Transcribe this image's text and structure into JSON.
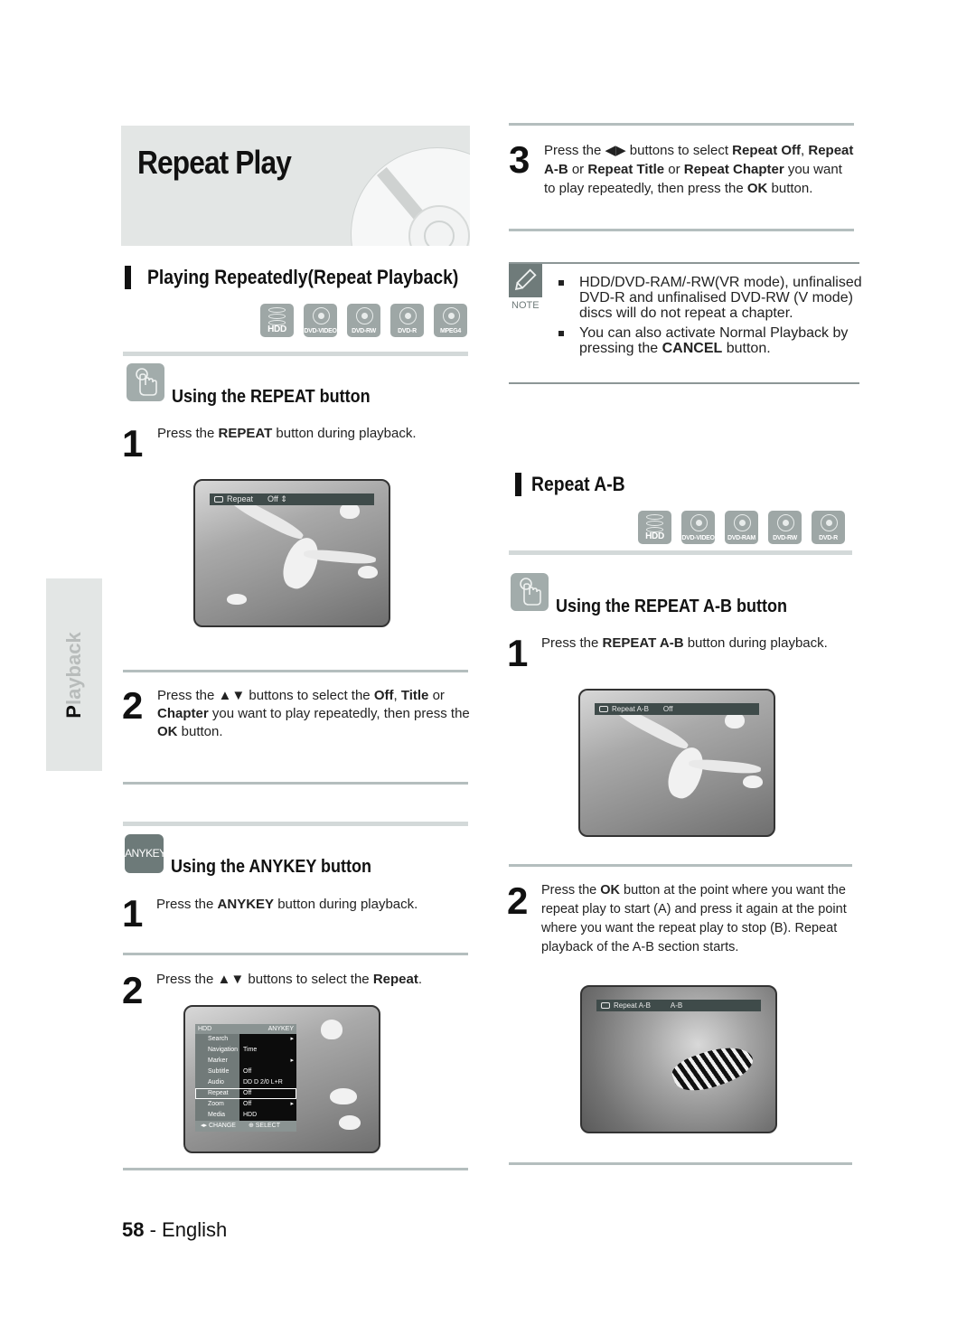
{
  "page": {
    "title": "Repeat Play",
    "side_tab": {
      "first_letter": "P",
      "rest": "layback"
    },
    "footer": {
      "page_number": "58",
      "separator": " - ",
      "language": "English"
    }
  },
  "left": {
    "section_title": "Playing Repeatedly(Repeat Playback)",
    "badges": [
      "HDD",
      "DVD-VIDEO",
      "DVD-RW",
      "DVD-R",
      "MPEG4"
    ],
    "repeat_button": {
      "heading": "Using the REPEAT button",
      "step1": {
        "num": "1",
        "pre": "Press the ",
        "bold": "REPEAT",
        "post": " button during playback."
      },
      "screen1_osd": {
        "label": "Repeat",
        "value": "Off",
        "arrows": "⇕"
      },
      "step2": {
        "num": "2",
        "t1": "Press the ▲▼ buttons to select the ",
        "b1": "Off",
        "t2": ", ",
        "b2": "Title",
        "t3": " or ",
        "b3": "Chapter",
        "t4": " you want to play repeatedly, then press the ",
        "b4": "OK",
        "t5": " button."
      }
    },
    "anykey": {
      "icon_label": "ANYKEY",
      "heading": "Using the ANYKEY button",
      "step1": {
        "num": "1",
        "pre": "Press the ",
        "bold": "ANYKEY",
        "post": " button during playback."
      },
      "step2": {
        "num": "2",
        "pre": "Press the ▲▼ buttons to select the ",
        "bold": "Repeat",
        "post": "."
      },
      "menu": {
        "header_left": "HDD",
        "header_right": "ANYKEY",
        "rows": [
          {
            "key": "Search",
            "value": "",
            "arrow": "▸"
          },
          {
            "key": "Navigation",
            "value": "Time",
            "arrow": ""
          },
          {
            "key": "Marker",
            "value": "",
            "arrow": "▸"
          },
          {
            "key": "Subtitle",
            "value": "Off",
            "arrow": ""
          },
          {
            "key": "Audio",
            "value": "DD D 2/0 L+R",
            "arrow": ""
          },
          {
            "key": "Repeat",
            "value": "Off",
            "arrow": ""
          },
          {
            "key": "Zoom",
            "value": "Off",
            "arrow": "▸"
          },
          {
            "key": "Media",
            "value": "HDD",
            "arrow": ""
          }
        ],
        "footer_change": "CHANGE",
        "footer_select": "SELECT"
      }
    }
  },
  "right": {
    "step3": {
      "num": "3",
      "t1": "Press the ◀▶ buttons to select ",
      "b1": "Repeat Off",
      "t2": ", ",
      "b2": "Repeat A-B",
      "t3": " or ",
      "b3": "Repeat Title",
      "t4": " or ",
      "b4": "Repeat Chapter",
      "t5": " you want to play repeatedly, then press the ",
      "b5": "OK",
      "t6": " button."
    },
    "note": {
      "label": "NOTE",
      "item1": "HDD/DVD-RAM/-RW(VR mode), unfinalised DVD-R and unfinalised DVD-RW (V mode) discs will do not repeat a chapter.",
      "item2_pre": "You can also activate Normal Playback by pressing the ",
      "item2_bold": "CANCEL",
      "item2_post": " button."
    },
    "ab": {
      "section_title": "Repeat A-B",
      "badges": [
        "HDD",
        "DVD-VIDEO",
        "DVD-RAM",
        "DVD-RW",
        "DVD-R"
      ],
      "heading": "Using the REPEAT A-B button",
      "step1": {
        "num": "1",
        "pre": "Press the ",
        "bold": "REPEAT A-B",
        "post": " button during playback."
      },
      "screen1_osd": {
        "label": "Repeat  A-B",
        "value": "Off"
      },
      "step2": {
        "num": "2",
        "pre": "Press the ",
        "bold": "OK",
        "post": " button at the point where you want the repeat play to start (A) and press it again at the point where you want the repeat play to stop (B). Repeat playback of the A-B section starts."
      },
      "screen2_osd": {
        "label": "Repeat  A-B",
        "value": "A-B"
      }
    }
  }
}
